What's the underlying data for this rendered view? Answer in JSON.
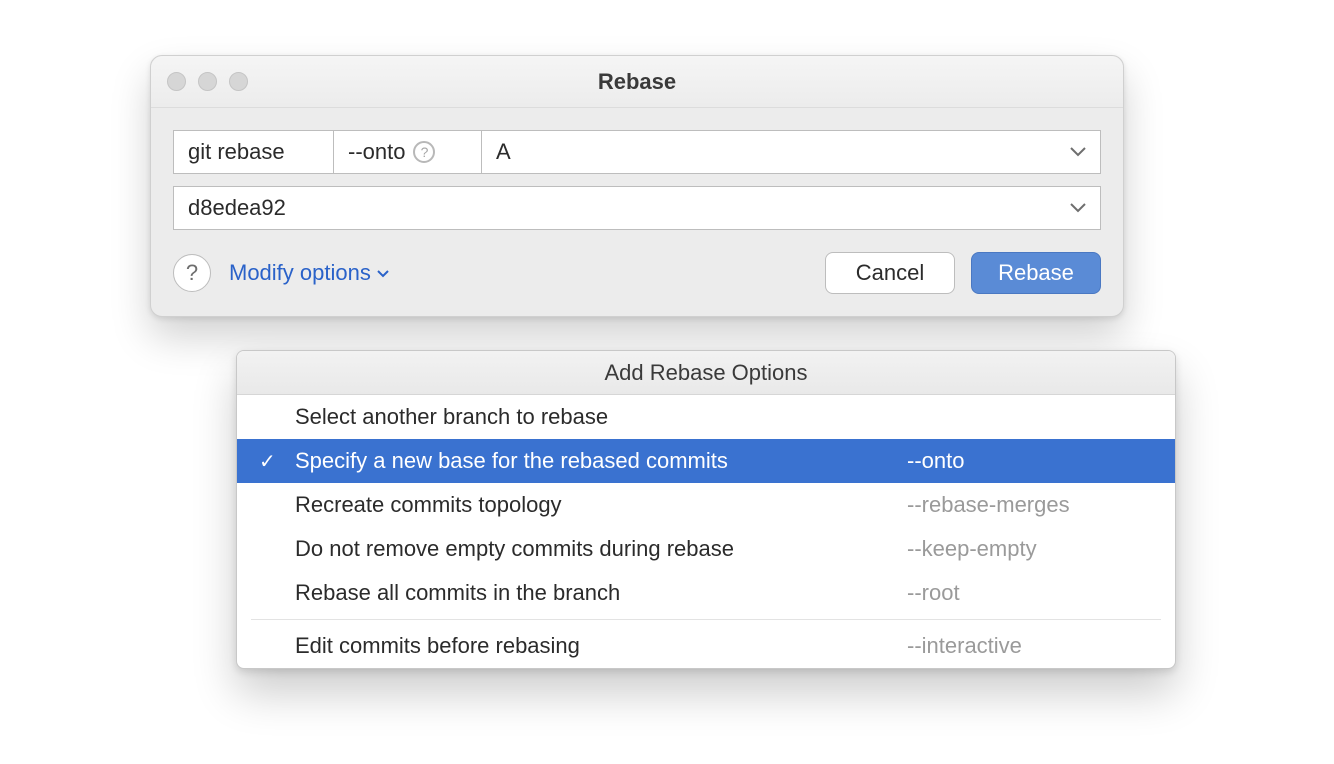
{
  "dialog": {
    "title": "Rebase",
    "command_label": "git rebase",
    "onto_label": "--onto",
    "new_base_value": "A",
    "commit_value": "d8edea92",
    "modify_options_label": "Modify options",
    "cancel_label": "Cancel",
    "rebase_label": "Rebase"
  },
  "popup": {
    "header": "Add Rebase Options",
    "items": [
      {
        "label": "Select another branch to rebase",
        "flag": "",
        "selected": false
      },
      {
        "label": "Specify a new base for the rebased commits",
        "flag": "--onto",
        "selected": true
      },
      {
        "label": "Recreate commits topology",
        "flag": "--rebase-merges",
        "selected": false
      },
      {
        "label": "Do not remove empty commits during rebase",
        "flag": "--keep-empty",
        "selected": false
      },
      {
        "label": "Rebase all commits in the branch",
        "flag": "--root",
        "selected": false
      }
    ],
    "separator_after_index": 4,
    "items2": [
      {
        "label": "Edit commits before rebasing",
        "flag": "--interactive",
        "selected": false
      }
    ]
  }
}
